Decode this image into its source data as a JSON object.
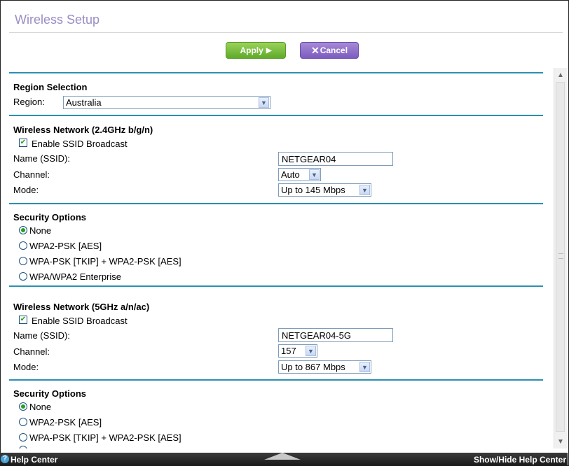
{
  "page": {
    "title": "Wireless Setup"
  },
  "actions": {
    "apply_label": "Apply",
    "cancel_label": "Cancel"
  },
  "region": {
    "section_title": "Region Selection",
    "label": "Region:",
    "value": "Australia"
  },
  "network_24": {
    "section_title": "Wireless Network (2.4GHz b/g/n)",
    "ssid_broadcast_label": "Enable SSID Broadcast",
    "ssid_broadcast_checked": true,
    "name_label": "Name (SSID):",
    "name_value": "NETGEAR04",
    "channel_label": "Channel:",
    "channel_value": "Auto",
    "mode_label": "Mode:",
    "mode_value": "Up to 145 Mbps"
  },
  "security_24": {
    "section_title": "Security Options",
    "options": [
      "None",
      "WPA2-PSK [AES]",
      "WPA-PSK [TKIP] + WPA2-PSK [AES]",
      "WPA/WPA2 Enterprise"
    ],
    "selected": "None"
  },
  "network_5": {
    "section_title": "Wireless Network (5GHz a/n/ac)",
    "ssid_broadcast_label": "Enable SSID Broadcast",
    "ssid_broadcast_checked": true,
    "name_label": "Name (SSID):",
    "name_value": "NETGEAR04-5G",
    "channel_label": "Channel:",
    "channel_value": "157",
    "mode_label": "Mode:",
    "mode_value": "Up to 867 Mbps"
  },
  "security_5": {
    "section_title": "Security Options",
    "options": [
      "None",
      "WPA2-PSK [AES]",
      "WPA-PSK [TKIP] + WPA2-PSK [AES]"
    ],
    "selected": "None"
  },
  "footer": {
    "help_label": "Help Center",
    "toggle_label": "Show/Hide Help Center"
  },
  "icons": {
    "apply": "play-triangle-icon",
    "cancel": "x-icon",
    "dropdown": "chevron-down-icon",
    "help": "question-circle-icon",
    "checkbox": "check-icon"
  },
  "colors": {
    "title": "#9a8dc4",
    "apply": "#5faa2a",
    "cancel": "#7c5cbf",
    "section_rule": "#2a90b0",
    "selection": "#21a121",
    "footer": "#2a2a2a"
  }
}
